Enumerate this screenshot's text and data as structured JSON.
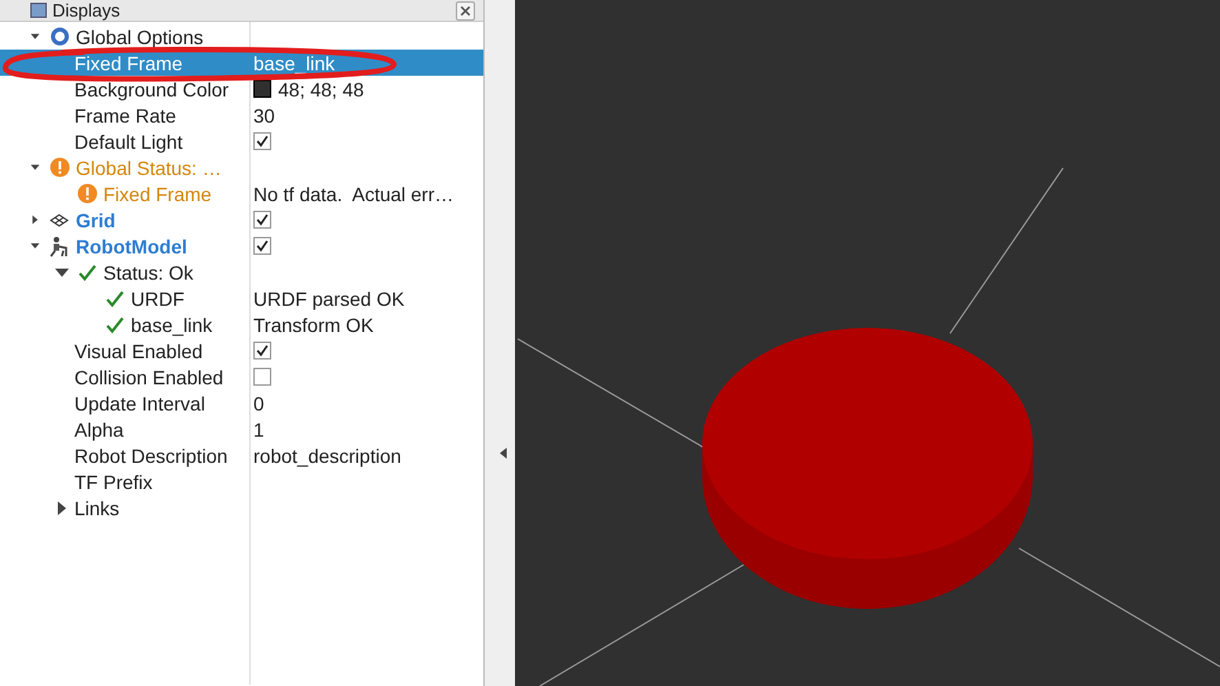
{
  "panel": {
    "title": "Displays"
  },
  "tree": [
    {
      "kind": "options",
      "label": "Global Options",
      "expanded": true,
      "selected": false,
      "children": [
        {
          "kind": "property",
          "label": "Fixed Frame",
          "value": "base_link",
          "selected": true
        },
        {
          "kind": "property",
          "label": "Background Color",
          "value": "48; 48; 48",
          "color": "#303030",
          "selected": false
        },
        {
          "kind": "property",
          "label": "Frame Rate",
          "value": "30",
          "selected": false
        },
        {
          "kind": "property",
          "label": "Default Light",
          "checked": true,
          "selected": false
        }
      ]
    },
    {
      "kind": "warning",
      "label": "Global Status: …",
      "expanded": true,
      "selected": false,
      "children": [
        {
          "kind": "warning",
          "label": "Fixed Frame",
          "value": "No tf data.  Actual err…",
          "selected": false
        }
      ]
    },
    {
      "kind": "grid",
      "label": "Grid",
      "expanded": false,
      "checked": true,
      "selected": false
    },
    {
      "kind": "robot",
      "label": "RobotModel",
      "expanded": true,
      "checked": true,
      "selected": false,
      "children": [
        {
          "kind": "ok",
          "label": "Status: Ok",
          "expanded": true,
          "selected": false,
          "children": [
            {
              "kind": "ok",
              "label": "URDF",
              "value": "URDF parsed OK",
              "selected": false
            },
            {
              "kind": "ok",
              "label": "base_link",
              "value": "Transform OK",
              "selected": false
            }
          ]
        },
        {
          "kind": "property",
          "label": "Visual Enabled",
          "checked": true,
          "selected": false
        },
        {
          "kind": "property",
          "label": "Collision Enabled",
          "checked": false,
          "selected": false
        },
        {
          "kind": "property",
          "label": "Update Interval",
          "value": "0",
          "selected": false
        },
        {
          "kind": "property",
          "label": "Alpha",
          "value": "1",
          "selected": false
        },
        {
          "kind": "property",
          "label": "Robot Description",
          "value": "robot_description",
          "selected": false
        },
        {
          "kind": "property",
          "label": "TF Prefix",
          "selected": false
        },
        {
          "kind": "property",
          "label": "Links",
          "expanded": false,
          "selected": false
        }
      ]
    }
  ]
}
